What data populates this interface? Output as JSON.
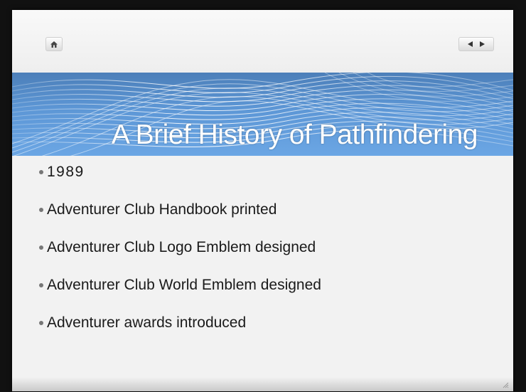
{
  "slide": {
    "title": "A Brief History of Pathfindering",
    "bullets": [
      "1989",
      "Adventurer Club Handbook printed",
      "Adventurer Club Logo Emblem designed",
      "Adventurer Club World Emblem designed",
      "Adventurer awards introduced"
    ]
  },
  "toolbar": {
    "home_icon": "home-icon",
    "prev_icon": "triangle-left-icon",
    "next_icon": "triangle-right-icon"
  },
  "colors": {
    "banner": "#5d97d6",
    "background": "#f2f2f2",
    "frame": "#111111"
  }
}
